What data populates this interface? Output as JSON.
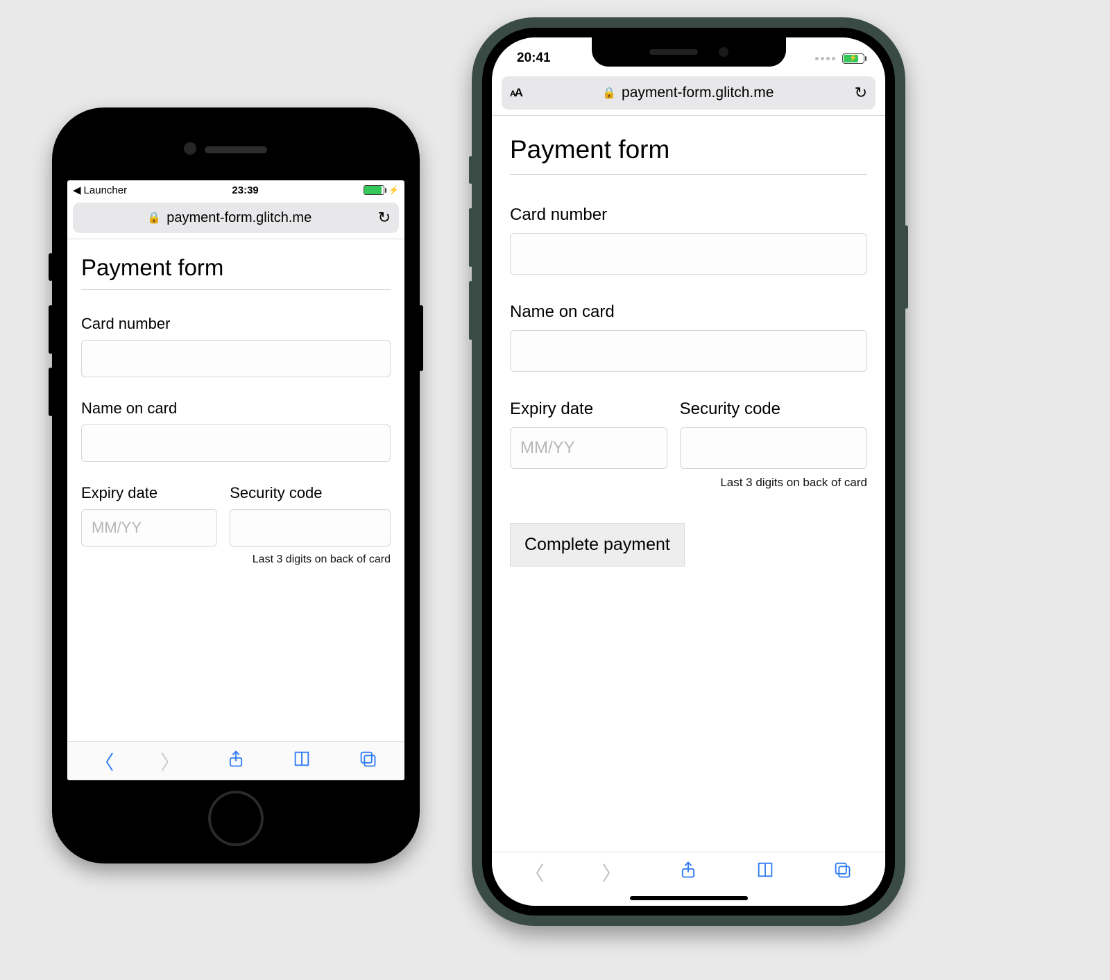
{
  "left_phone": {
    "status": {
      "back_app": "Launcher",
      "time": "23:39"
    },
    "browser": {
      "url": "payment-form.glitch.me"
    },
    "page": {
      "title": "Payment form",
      "card_number_label": "Card number",
      "name_label": "Name on card",
      "expiry_label": "Expiry date",
      "expiry_placeholder": "MM/YY",
      "cvc_label": "Security code",
      "cvc_helper": "Last 3 digits on back of card"
    }
  },
  "right_phone": {
    "status": {
      "time": "20:41"
    },
    "browser": {
      "aa": "AA",
      "url": "payment-form.glitch.me"
    },
    "page": {
      "title": "Payment form",
      "card_number_label": "Card number",
      "name_label": "Name on card",
      "expiry_label": "Expiry date",
      "expiry_placeholder": "MM/YY",
      "cvc_label": "Security code",
      "cvc_helper": "Last 3 digits on back of card",
      "submit_label": "Complete payment"
    }
  }
}
